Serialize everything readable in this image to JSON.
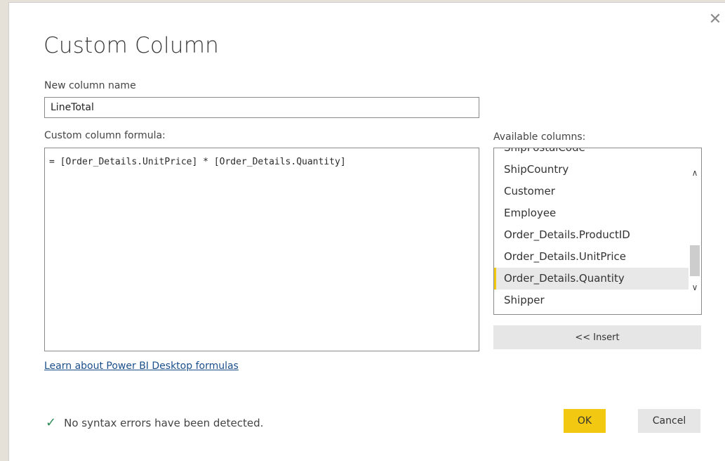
{
  "dialog": {
    "title": "Custom Column",
    "close_icon": "close-icon"
  },
  "column_name": {
    "label": "New column name",
    "value": "LineTotal"
  },
  "formula": {
    "label": "Custom column formula:",
    "value": "= [Order_Details.UnitPrice] * [Order_Details.Quantity]"
  },
  "available_columns": {
    "label": "Available columns:",
    "items": [
      "ShipPostalCode",
      "ShipCountry",
      "Customer",
      "Employee",
      "Order_Details.ProductID",
      "Order_Details.UnitPrice",
      "Order_Details.Quantity",
      "Shipper"
    ],
    "selected": "Order_Details.Quantity",
    "insert_label": "<< Insert"
  },
  "learn_link": "Learn about Power BI Desktop formulas",
  "status": {
    "icon": "checkmark-icon",
    "text": "No syntax errors have been detected."
  },
  "buttons": {
    "ok": "OK",
    "cancel": "Cancel"
  },
  "colors": {
    "accent": "#f2c811",
    "link": "#1a4f8a",
    "success": "#2e8b57"
  }
}
